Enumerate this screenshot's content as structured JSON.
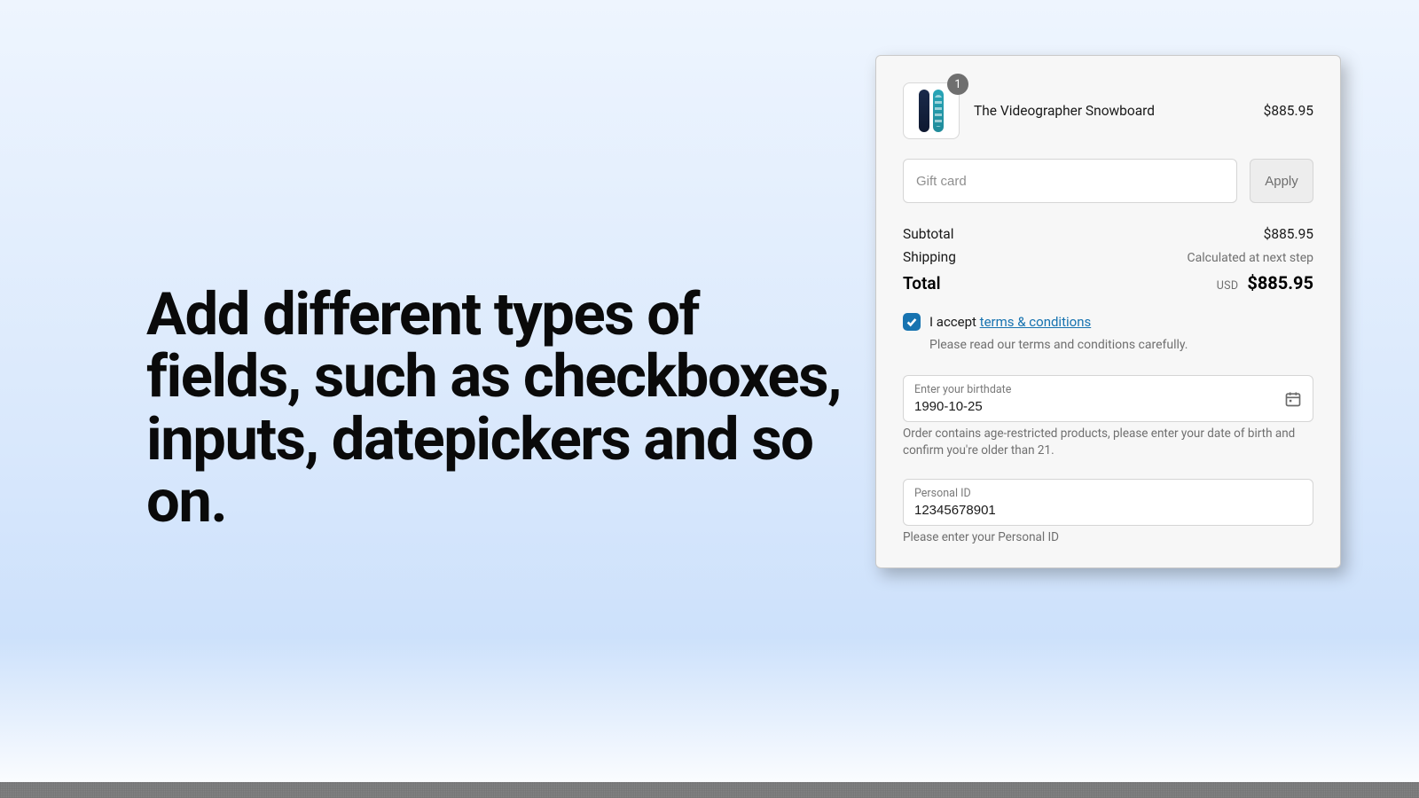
{
  "headline": "Add different types of fields, such as checkboxes, inputs, datepickers and so on.",
  "product": {
    "qty": "1",
    "name": "The Videographer Snowboard",
    "price": "$885.95"
  },
  "giftcard": {
    "placeholder": "Gift card",
    "apply_label": "Apply"
  },
  "summary": {
    "subtotal_label": "Subtotal",
    "subtotal_value": "$885.95",
    "shipping_label": "Shipping",
    "shipping_note": "Calculated at next step",
    "total_label": "Total",
    "total_currency": "USD",
    "total_value": "$885.95"
  },
  "terms": {
    "accept_prefix": "I accept ",
    "link_text": "terms & conditions",
    "hint": "Please read our terms and conditions carefully."
  },
  "birthdate": {
    "label": "Enter your birthdate",
    "value": "1990-10-25",
    "help": "Order contains age-restricted products, please enter your date of birth and confirm you're older than 21."
  },
  "personal_id": {
    "label": "Personal ID",
    "value": "12345678901",
    "help": "Please enter your Personal ID"
  }
}
